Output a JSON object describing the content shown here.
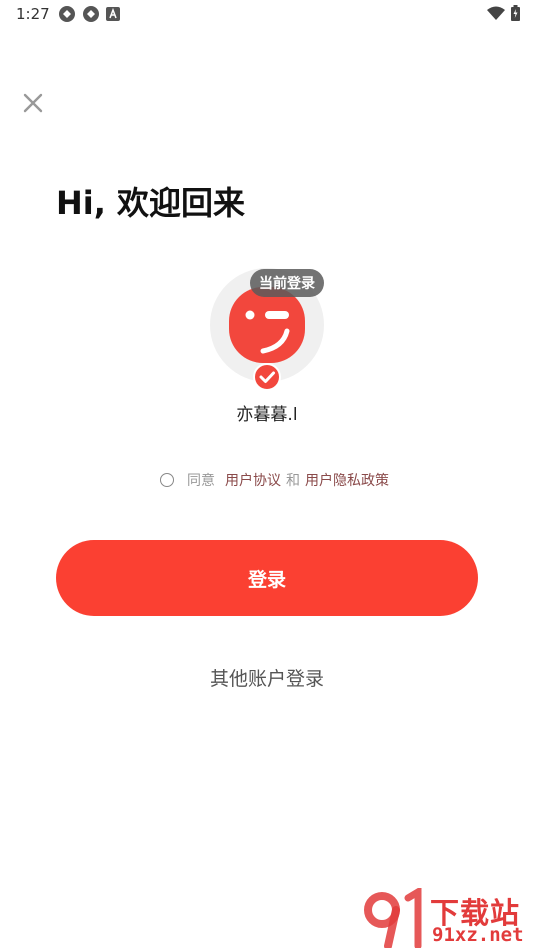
{
  "status_bar": {
    "time": "1:27",
    "left_icons": [
      "sync-icon",
      "sync-icon",
      "a-notification-icon"
    ],
    "right_icons": [
      "wifi-icon",
      "battery-icon"
    ]
  },
  "header": {
    "title": "Hi, 欢迎回来"
  },
  "account": {
    "badge": "当前登录",
    "username": "亦暮暮.l",
    "avatar_color": "#f2473d"
  },
  "agreement": {
    "prefix": "同意",
    "user_agreement": "用户协议",
    "conjunction": "和",
    "privacy_policy": "用户隐私政策",
    "checked": false
  },
  "actions": {
    "login_label": "登录",
    "other_login_label": "其他账户登录"
  },
  "watermark": {
    "title": "下载站",
    "url": "91xz.net"
  },
  "colors": {
    "accent": "#fb4032",
    "link": "#8a4a4a"
  }
}
